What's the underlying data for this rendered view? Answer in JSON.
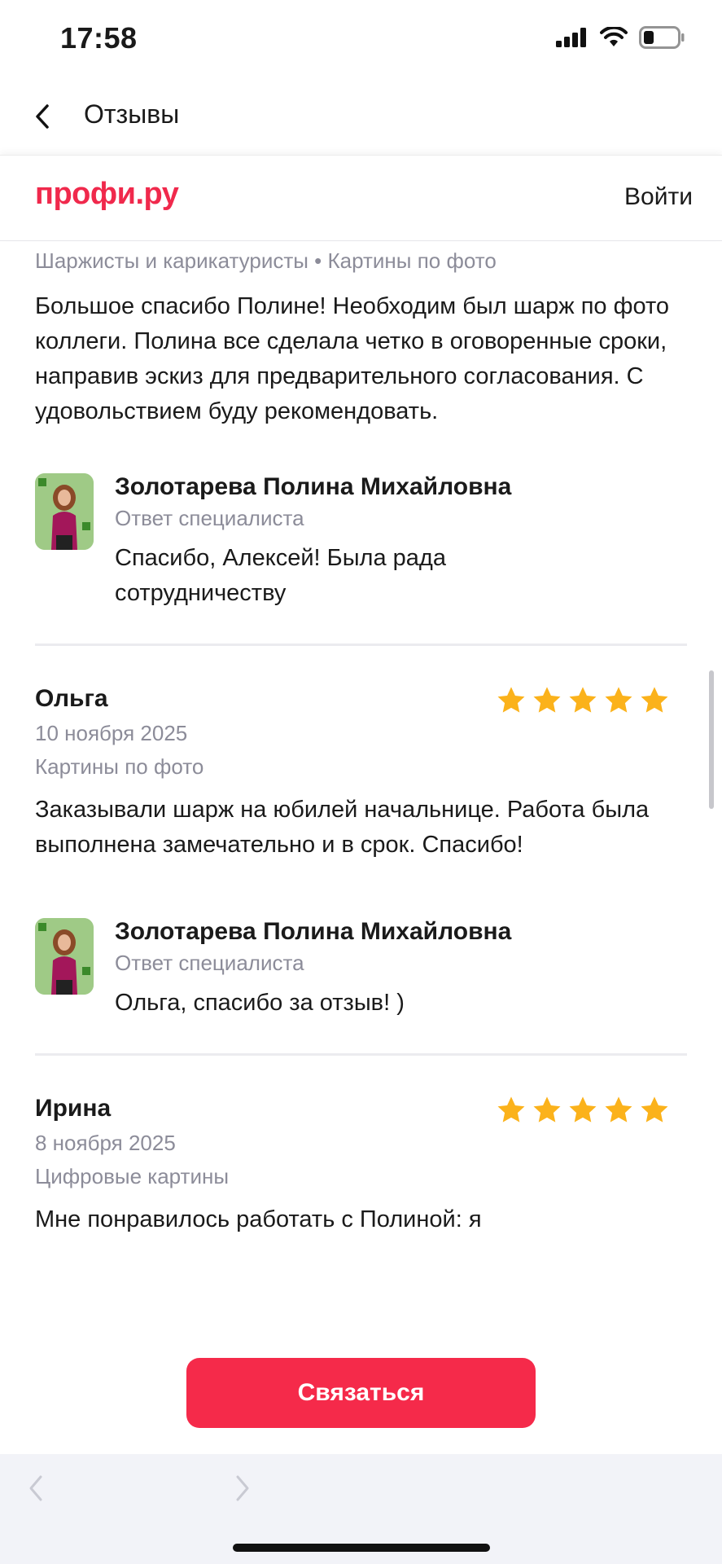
{
  "status": {
    "time": "17:58",
    "icons": [
      "signal-icon",
      "wifi-icon",
      "battery-icon"
    ]
  },
  "nav": {
    "back_icon": "chevron-left-icon",
    "title": "Отзывы"
  },
  "web_header": {
    "logo": "профи.ру",
    "login": "Войти"
  },
  "reviews": [
    {
      "categories": "Шаржисты и карикатуристы • Картины по фото",
      "text": "Большое спасибо Полине! Необходим был шарж по фото коллеги. Полина все сделала четко в оговоренные сроки, направив эскиз для предварительного согласования. С удовольствием буду рекомендовать.",
      "reply": {
        "name": "Золотарева Полина Михайловна",
        "role": "Ответ специалиста",
        "text": "Спасибо, Алексей! Была рада сотрудничеству"
      }
    },
    {
      "name": "Ольга",
      "date": "10 ноября 2025",
      "categories": "Картины по фото",
      "rating": 5,
      "text": "Заказывали шарж на юбилей начальнице. Работа была выполнена замечательно и в срок. Спасибо!",
      "reply": {
        "name": "Золотарева Полина Михайловна",
        "role": "Ответ специалиста",
        "text": "Ольга, спасибо за отзыв! )"
      }
    },
    {
      "name": "Ирина",
      "date": "8 ноября 2025",
      "categories": "Цифровые картины",
      "rating": 5,
      "text": "Мне понравилось работать с Полиной: я"
    }
  ],
  "cta": {
    "label": "Связаться"
  },
  "colors": {
    "brand": "#f0294c",
    "button": "#f52a4a",
    "star": "#fbb21b",
    "muted_text": "#8c8c99"
  }
}
